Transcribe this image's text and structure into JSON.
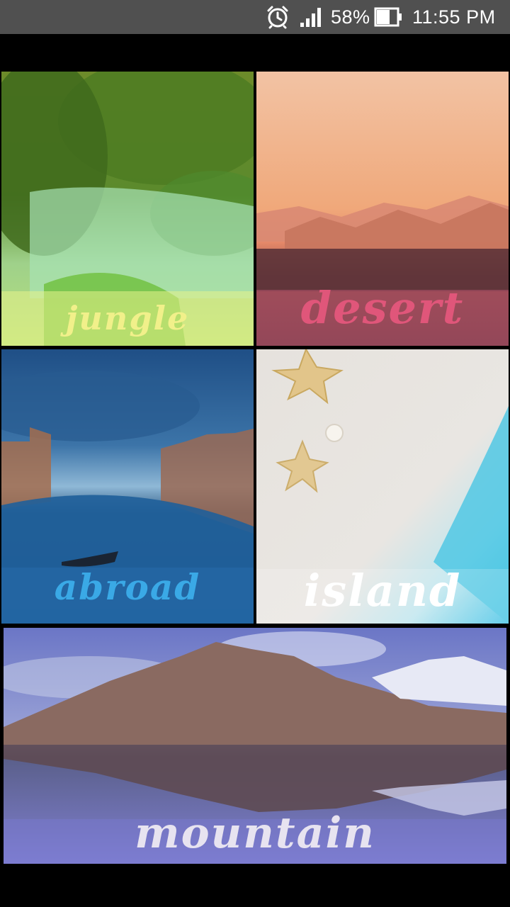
{
  "status_bar": {
    "battery_percent": "58%",
    "time": "11:55 PM",
    "icons": [
      "alarm-icon",
      "signal-icon",
      "battery-icon"
    ]
  },
  "tiles": [
    {
      "id": "jungle",
      "label": "jungle",
      "label_color": "#f1f08a"
    },
    {
      "id": "desert",
      "label": "desert",
      "label_color": "#e0567a"
    },
    {
      "id": "abroad",
      "label": "abroad",
      "label_color": "#3aa9e6"
    },
    {
      "id": "island",
      "label": "island",
      "label_color": "#ffffff"
    },
    {
      "id": "mountain",
      "label": "mountain",
      "label_color": "#e7e3f0"
    }
  ]
}
